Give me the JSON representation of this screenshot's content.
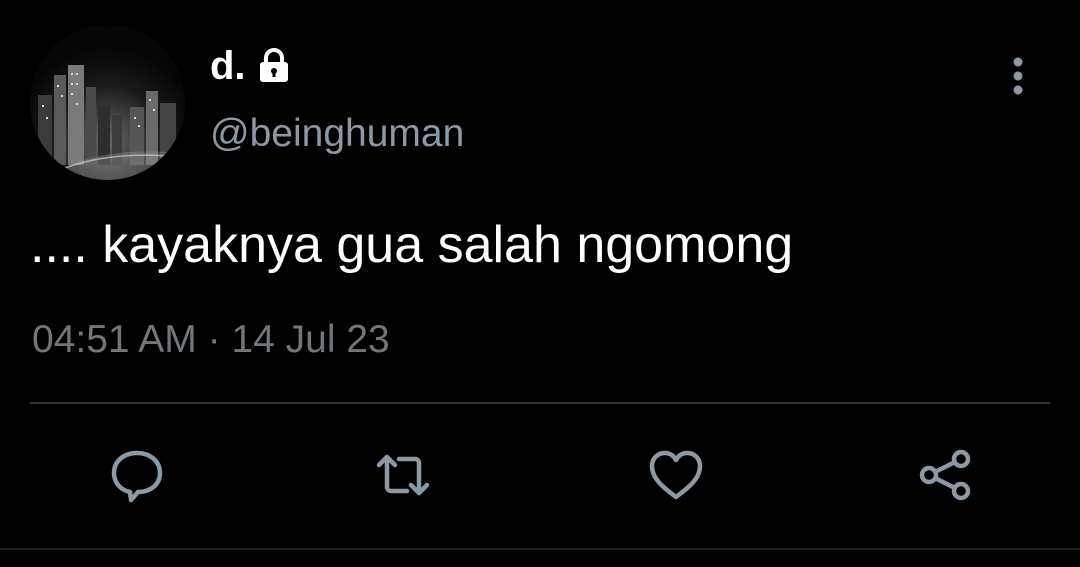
{
  "tweet": {
    "display_name": "d.",
    "handle": "@beinghuman",
    "text": ".... kayaknya gua salah ngomong",
    "timestamp": "04:51 AM · 14 Jul 23",
    "is_protected": true
  },
  "icons": {
    "lock": "lock-icon",
    "more": "more-vertical-icon",
    "reply": "reply-icon",
    "retweet": "retweet-icon",
    "like": "heart-icon",
    "share": "share-icon"
  },
  "colors": {
    "background": "#000000",
    "primary_text": "#ffffff",
    "secondary_text": "#71767b",
    "icon": "#8b98a5",
    "divider": "#2f3336"
  }
}
